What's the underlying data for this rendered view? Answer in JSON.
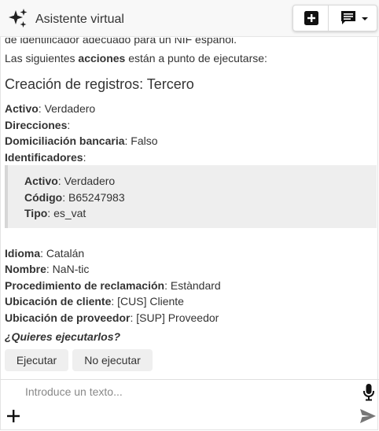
{
  "header": {
    "title": "Asistente virtual"
  },
  "conversation": {
    "partial_line": "de identificador adecuado para un NIF español.",
    "intro_prefix": "Las siguientes ",
    "intro_bold": "acciones",
    "intro_suffix": " están a punto de ejecutarse:",
    "section_title": "Creación de registros: Tercero",
    "fields_top": [
      {
        "label": "Activo",
        "value": ": Verdadero"
      },
      {
        "label": "Direcciones",
        "value": ":"
      },
      {
        "label": "Domiciliación bancaria",
        "value": ": Falso"
      },
      {
        "label": "Identificadores",
        "value": ":"
      }
    ],
    "identifier_fields": [
      {
        "label": "Activo",
        "value": ": Verdadero"
      },
      {
        "label": "Código",
        "value": ": B65247983"
      },
      {
        "label": "Tipo",
        "value": ": es_vat"
      }
    ],
    "fields_bottom": [
      {
        "label": "Idioma",
        "value": ": Catalán"
      },
      {
        "label": "Nombre",
        "value": ": NaN-tic"
      },
      {
        "label": "Procedimiento de reclamación",
        "value": ": Estàndard"
      },
      {
        "label": "Ubicación de cliente",
        "value": ": [CUS] Cliente"
      },
      {
        "label": "Ubicación de proveedor",
        "value": ": [SUP] Proveedor"
      }
    ],
    "question": "¿Quieres ejecutarlos?",
    "execute_label": "Ejecutar",
    "dont_execute_label": "No ejecutar"
  },
  "composer": {
    "placeholder": "Introduce un texto...",
    "value": ""
  },
  "icons": {
    "header_logo": "sparkles-icon",
    "new_chat": "plus-square-icon",
    "history": "comment-list-icon",
    "dropdown": "caret-down-icon",
    "mic": "microphone-icon",
    "attach": "plus-icon",
    "send": "send-icon"
  }
}
